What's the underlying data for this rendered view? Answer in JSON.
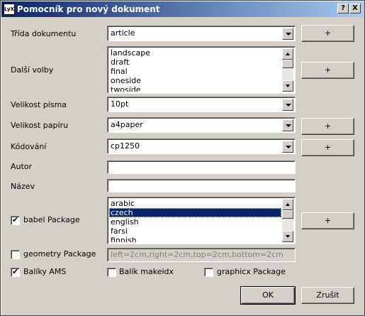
{
  "window": {
    "app_icon": "LyX",
    "title": "Pomocník pro nový dokument",
    "help_button": "?",
    "close_button": "X"
  },
  "form": {
    "doc_class": {
      "label": "Třída dokumentu",
      "value": "article",
      "add_label": "+"
    },
    "options": {
      "label": "Další volby",
      "items": [
        "landscape",
        "draft",
        "final",
        "oneside",
        "twoside"
      ],
      "add_label": "+"
    },
    "font_size": {
      "label": "Velikost písma",
      "value": "10pt"
    },
    "paper_size": {
      "label": "Velikost papíru",
      "value": "a4paper",
      "add_label": "+"
    },
    "encoding": {
      "label": "Kódování",
      "value": "cp1250",
      "add_label": "+"
    },
    "author": {
      "label": "Autor",
      "value": ""
    },
    "title": {
      "label": "Název",
      "value": ""
    },
    "babel": {
      "label": "babel Package",
      "checked": true,
      "items": [
        "arabic",
        "czech",
        "english",
        "farsi",
        "finnish"
      ],
      "selected": "czech",
      "add_label": "+"
    },
    "geometry": {
      "label": "geometry Package",
      "checked": false,
      "value": "left=2cm,right=2cm,top=2cm,bottom=2cm"
    },
    "ams": {
      "label": "Balíky AMS",
      "checked": true
    },
    "makeidx": {
      "label": "Balík makeidx",
      "checked": false
    },
    "graphicx": {
      "label": "graphicx Package",
      "checked": false
    }
  },
  "actions": {
    "ok": "OK",
    "cancel": "Zrušit"
  },
  "colors": {
    "titlebar_start": "#0a246a",
    "titlebar_end": "#a6caf0",
    "selection": "#0a246a",
    "face": "#d4d0c8"
  }
}
